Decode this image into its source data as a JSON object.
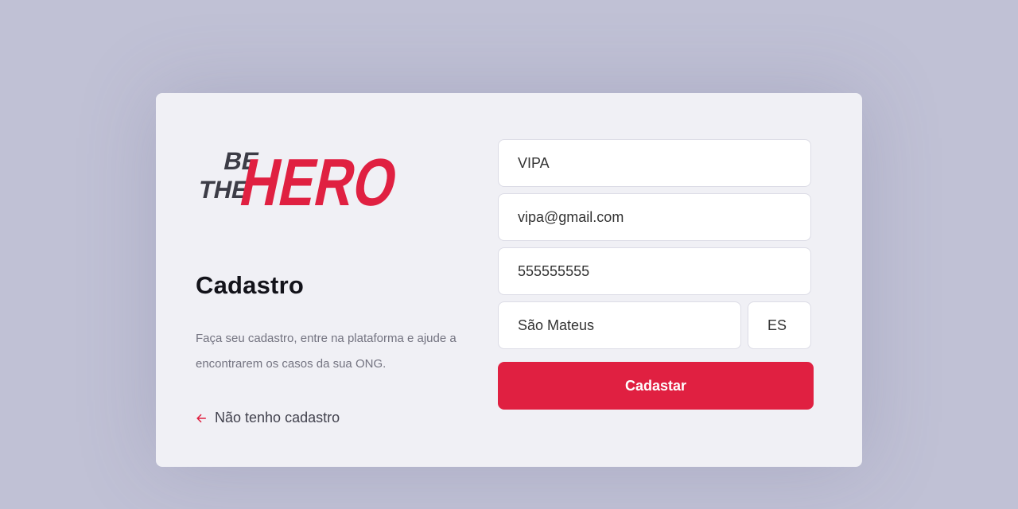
{
  "logo": {
    "alt": "Be The Hero",
    "line1": "BE",
    "line2": "THE",
    "main": "HERO",
    "dark_color": "#3c3c46",
    "brand_color": "#e02041"
  },
  "page": {
    "title": "Cadastro",
    "description": "Faça seu cadastro, entre na plataforma e ajude a encontrarem os casos da sua ONG.",
    "back_link_label": "Não tenho cadastro",
    "back_link_icon": "arrow-left-icon"
  },
  "form": {
    "name_value": "VIPA",
    "email_value": "vipa@gmail.com",
    "whatsapp_value": "555555555",
    "city_value": "São Mateus",
    "uf_value": "ES",
    "submit_label": "Cadastar"
  },
  "colors": {
    "background": "#c0c1d5",
    "card": "#f0f0f5",
    "accent": "#e02041"
  }
}
